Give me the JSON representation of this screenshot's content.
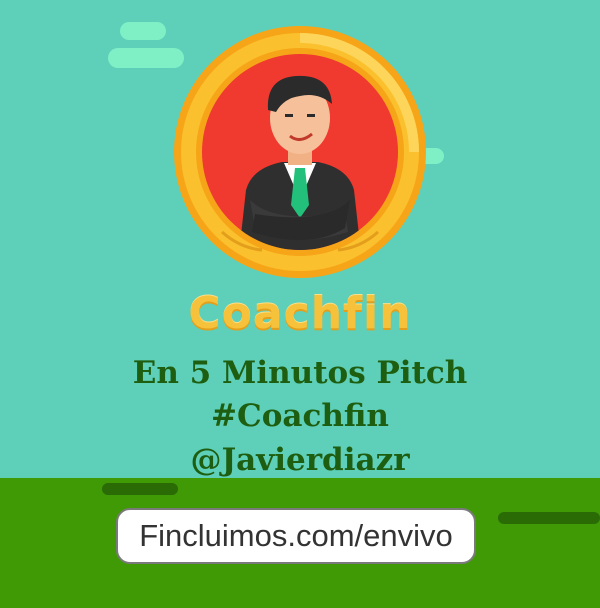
{
  "brand": {
    "name": "Coachfin"
  },
  "headline": {
    "line1": "En 5 Minutos Pitch",
    "line2": "#Coachfin",
    "line3": "@Javierdiazr"
  },
  "link": {
    "url": "Fincluimos.com/envivo"
  },
  "colors": {
    "sky": "#5ecfb8",
    "ground": "#3f9a06",
    "gold": "#f6c13b",
    "medallion_red": "#f0392f",
    "text_green": "#1e5e10"
  },
  "icons": {
    "emblem": "businessman-coin-icon"
  }
}
